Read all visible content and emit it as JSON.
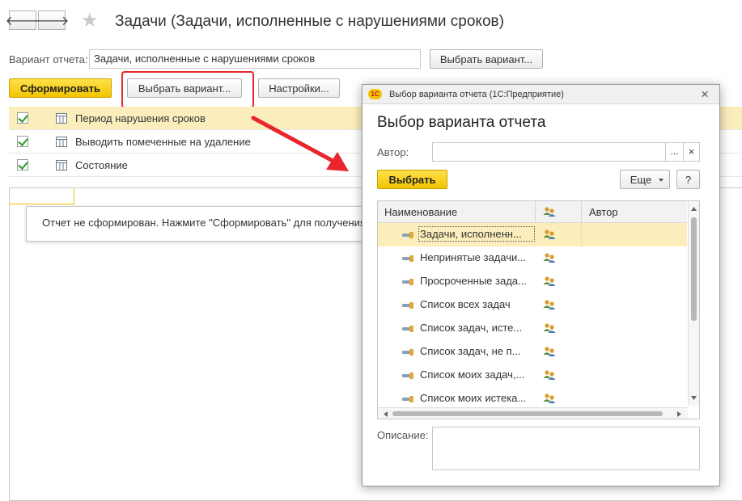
{
  "window": {
    "title": "Задачи (Задачи, исполненные с нарушениями сроков)",
    "back_glyph": "🡐",
    "forward_glyph": "🡒",
    "favorite_glyph": "★"
  },
  "variant": {
    "label": "Вариант отчета:",
    "value": "Задачи, исполненные с нарушениями сроков",
    "choose_button": "Выбрать вариант..."
  },
  "toolbar": {
    "generate": "Сформировать",
    "choose_variant": "Выбрать вариант...",
    "settings": "Настройки..."
  },
  "params": [
    {
      "label": "Период нарушения сроков",
      "checked": true
    },
    {
      "label": "Выводить помеченные на удаление",
      "checked": true
    },
    {
      "label": "Состояние",
      "checked": true
    }
  ],
  "report": {
    "message": "Отчет не сформирован. Нажмите \"Сформировать\" для получения"
  },
  "dialog": {
    "app_logo": "1С",
    "window_title": "Выбор варианта отчета  (1С:Предприятие)",
    "heading": "Выбор варианта отчета",
    "author_label": "Автор:",
    "author_value": "",
    "select_button": "Выбрать",
    "more_button": "Еще",
    "help_button": "?",
    "ellipsis_button": "...",
    "clear_button": "×",
    "close_glyph": "×",
    "columns": {
      "name": "Наименование",
      "author": "Автор"
    },
    "rows": [
      "Задачи, исполненн...",
      "Непринятые задачи...",
      "Просроченные зада...",
      "Список всех задач",
      "Список задач, исте...",
      "Список задач, не п...",
      "Список моих задач,...",
      "Список моих истека..."
    ],
    "description_label": "Описание:"
  },
  "colors": {
    "accent_yellow": "#f2c400",
    "selected_row": "#fbeebc",
    "highlight_red": "#e8262b",
    "check_green": "#2a9a2a"
  }
}
